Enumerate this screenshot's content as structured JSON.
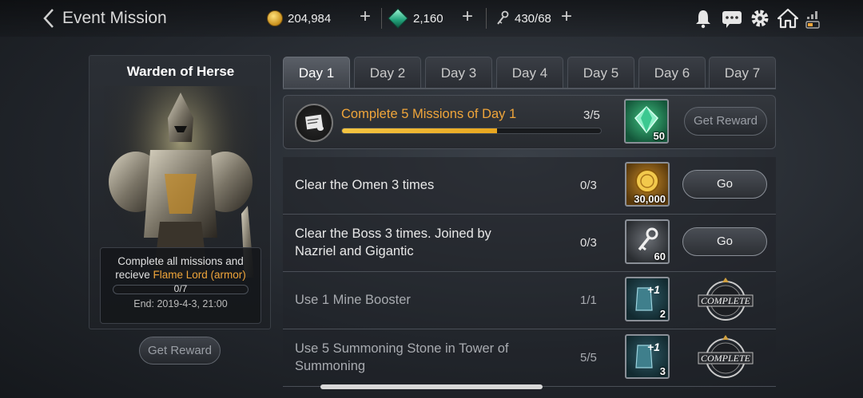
{
  "header": {
    "title": "Event Mission",
    "gold": "204,984",
    "gems": "2,160",
    "stamina": "430/68"
  },
  "left_panel": {
    "title": "Warden of Herse",
    "desc_prefix": "Complete all missions and recieve ",
    "desc_highlight": "Flame Lord (armor)",
    "progress": "0/7",
    "progress_fraction": 0,
    "end_date": "End: 2019-4-3, 21:00",
    "get_reward_label": "Get Reward"
  },
  "tabs": [
    {
      "label": "Day 1",
      "active": true
    },
    {
      "label": "Day 2",
      "active": false
    },
    {
      "label": "Day 3",
      "active": false
    },
    {
      "label": "Day 4",
      "active": false
    },
    {
      "label": "Day 5",
      "active": false
    },
    {
      "label": "Day 6",
      "active": false
    },
    {
      "label": "Day 7",
      "active": false
    }
  ],
  "main_mission": {
    "title": "Complete 5 Missions of Day 1",
    "progress": "3/5",
    "progress_fraction": 0.6,
    "reward_qty": "50",
    "button_label": "Get Reward"
  },
  "missions": [
    {
      "label_line1": "Clear the Omen 3 times",
      "label_line2": "",
      "progress": "0/3",
      "reward_qty": "30,000",
      "status": "Go"
    },
    {
      "label_line1": "Clear the Boss 3 times. Joined by",
      "label_line2": "Nazriel and Gigantic",
      "progress": "0/3",
      "reward_qty": "60",
      "status": "Go"
    },
    {
      "label_line1": "Use 1 Mine Booster",
      "label_line2": "",
      "progress": "1/1",
      "reward_qty": "2",
      "reward_plus": "+1",
      "status": "COMPLETE"
    },
    {
      "label_line1": "Use 5 Summoning Stone in Tower of",
      "label_line2": "Summoning",
      "progress": "5/5",
      "reward_qty": "3",
      "reward_plus": "+1",
      "status": "COMPLETE"
    }
  ],
  "colors": {
    "accent_orange": "#f0a53a",
    "progress_fill": "#f5c542",
    "gem_green": "#22a27a"
  },
  "icons": [
    "back-chevron-icon",
    "gold-coin-icon",
    "gem-icon",
    "key-icon",
    "bell-icon",
    "chat-icon",
    "gear-icon",
    "home-icon",
    "signal-icon"
  ]
}
